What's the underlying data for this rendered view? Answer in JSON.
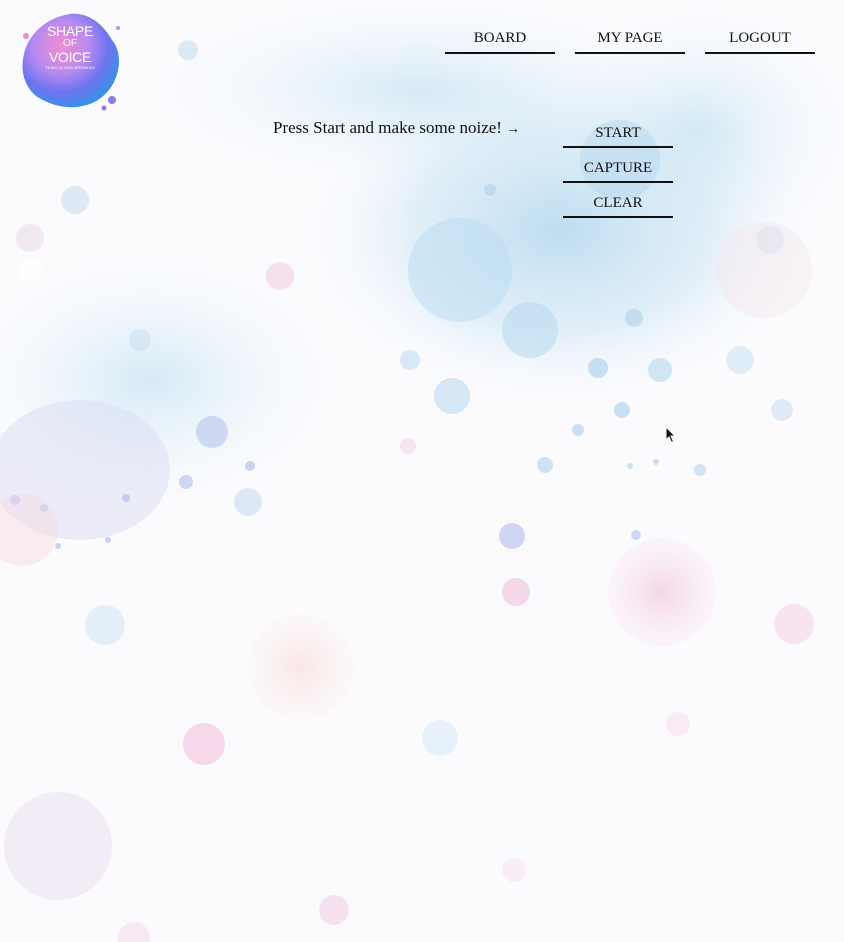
{
  "logo": {
    "line1": "SHAPE",
    "line2": "OF",
    "line3": "VOICE",
    "tagline": "TEAM CLOUD BREWING"
  },
  "nav": {
    "board": "BOARD",
    "mypage": "MY PAGE",
    "logout": "LOGOUT"
  },
  "prompt": {
    "text": "Press Start and make some noize!",
    "arrow": "→"
  },
  "controls": {
    "start": "START",
    "capture": "CAPTURE",
    "clear": "CLEAR"
  },
  "colors": {
    "background": "#fbfbfe",
    "text": "#111111",
    "accent_blue": "#9ccbe6",
    "accent_pink": "#f0b8d8"
  }
}
